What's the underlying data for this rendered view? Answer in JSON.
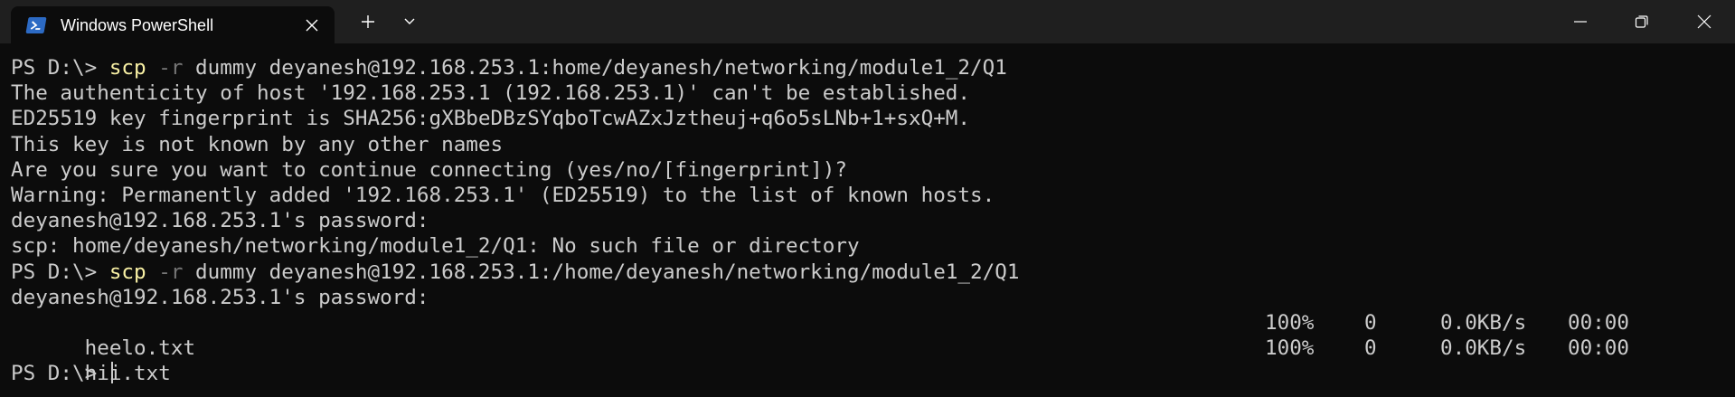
{
  "window": {
    "tab_title": "Windows PowerShell",
    "colors": {
      "titlebar_bg": "#1f1f1f",
      "terminal_bg": "#0c0c0c",
      "text": "#cccccc",
      "command": "#f9f1a5",
      "flag": "#767676",
      "icon": "#2c6ac4"
    },
    "icons": {
      "tab": "powershell-icon",
      "tab_close": "close-icon",
      "new_tab": "plus-icon",
      "dropdown": "chevron-down-icon",
      "minimize": "minimize-icon",
      "maximize": "maximize-icon",
      "close": "close-icon"
    }
  },
  "terminal": {
    "line1": {
      "prompt": "PS D:\\> ",
      "cmd": "scp",
      "flag": " -r",
      "args": " dummy deyanesh@192.168.253.1:home/deyanesh/networking/module1_2/Q1"
    },
    "line2": "The authenticity of host '192.168.253.1 (192.168.253.1)' can't be established.",
    "line3": "ED25519 key fingerprint is SHA256:gXBbeDBzSYqboTcwAZxJztheuj+q6o5sLNb+1+sxQ+M.",
    "line4": "This key is not known by any other names",
    "line5": "Are you sure you want to continue connecting (yes/no/[fingerprint])?",
    "line6": "Warning: Permanently added '192.168.253.1' (ED25519) to the list of known hosts.",
    "line7": "deyanesh@192.168.253.1's password:",
    "line8": "scp: home/deyanesh/networking/module1_2/Q1: No such file or directory",
    "line9": {
      "prompt": "PS D:\\> ",
      "cmd": "scp",
      "flag": " -r",
      "args": " dummy deyanesh@192.168.253.1:/home/deyanesh/networking/module1_2/Q1"
    },
    "line10": "deyanesh@192.168.253.1's password:",
    "transfers": [
      {
        "file": "heelo.txt",
        "percent": "100%",
        "bytes": "0",
        "rate": "0.0KB/s",
        "time": "00:00"
      },
      {
        "file": "hii.txt",
        "percent": "100%",
        "bytes": "0",
        "rate": "0.0KB/s",
        "time": "00:00"
      }
    ],
    "final_prompt": "PS D:\\> "
  }
}
